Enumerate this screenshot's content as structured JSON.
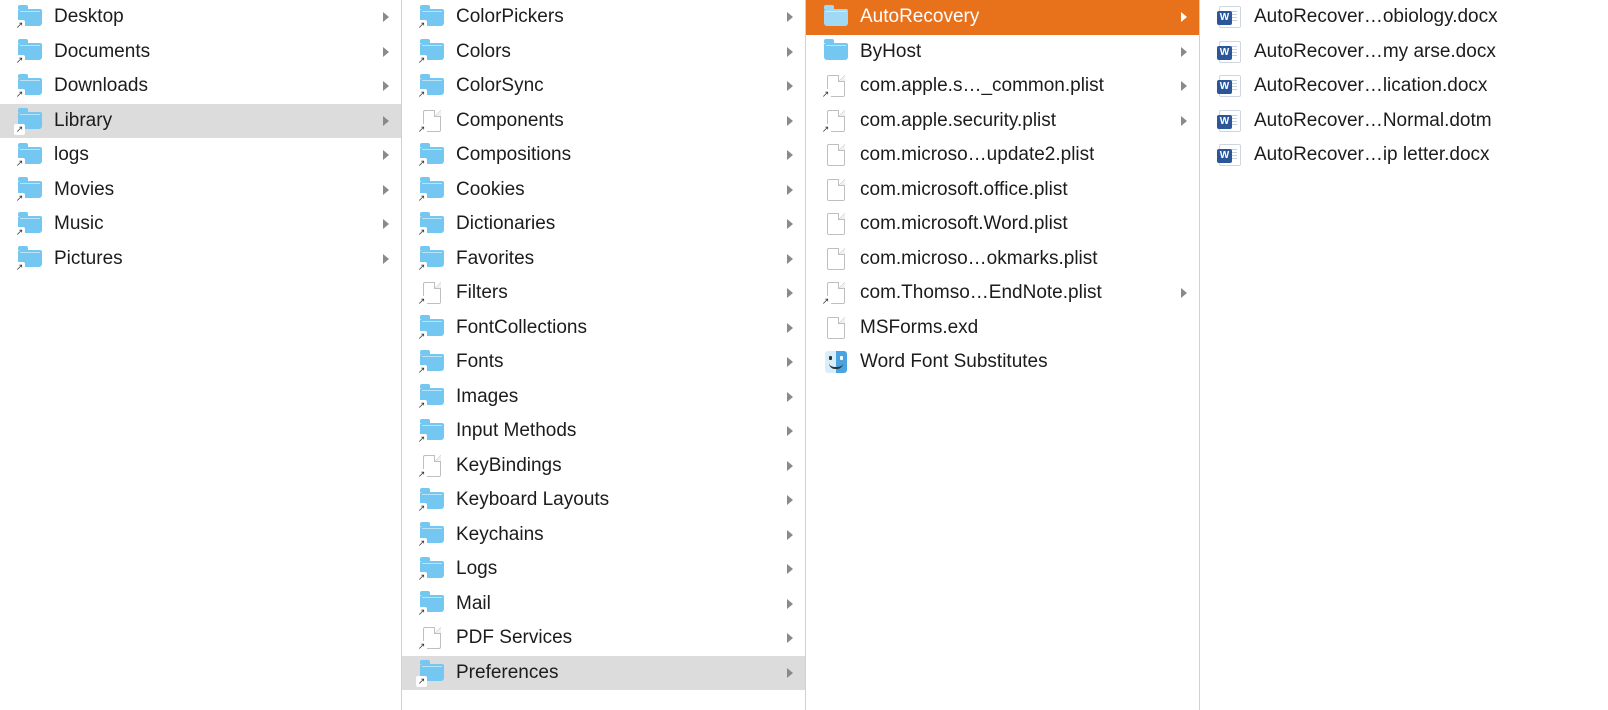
{
  "columns": [
    {
      "id": "home",
      "items": [
        {
          "label": "Desktop",
          "icon": "folder-alias",
          "arrow": true,
          "selected": false
        },
        {
          "label": "Documents",
          "icon": "folder-alias",
          "arrow": true,
          "selected": false
        },
        {
          "label": "Downloads",
          "icon": "folder-alias",
          "arrow": true,
          "selected": false
        },
        {
          "label": "Library",
          "icon": "folder-alias",
          "arrow": true,
          "selected": "gray"
        },
        {
          "label": "logs",
          "icon": "folder-alias",
          "arrow": true,
          "selected": false
        },
        {
          "label": "Movies",
          "icon": "folder-alias",
          "arrow": true,
          "selected": false
        },
        {
          "label": "Music",
          "icon": "folder-alias",
          "arrow": true,
          "selected": false
        },
        {
          "label": "Pictures",
          "icon": "folder-alias",
          "arrow": true,
          "selected": false
        }
      ]
    },
    {
      "id": "library",
      "items": [
        {
          "label": "ColorPickers",
          "icon": "folder-alias",
          "arrow": true
        },
        {
          "label": "Colors",
          "icon": "folder-alias",
          "arrow": true
        },
        {
          "label": "ColorSync",
          "icon": "folder-alias",
          "arrow": true
        },
        {
          "label": "Components",
          "icon": "file-alias",
          "arrow": true
        },
        {
          "label": "Compositions",
          "icon": "folder-alias",
          "arrow": true
        },
        {
          "label": "Cookies",
          "icon": "folder-alias",
          "arrow": true
        },
        {
          "label": "Dictionaries",
          "icon": "folder-alias",
          "arrow": true
        },
        {
          "label": "Favorites",
          "icon": "folder-alias",
          "arrow": true
        },
        {
          "label": "Filters",
          "icon": "file-alias",
          "arrow": true
        },
        {
          "label": "FontCollections",
          "icon": "folder-alias",
          "arrow": true
        },
        {
          "label": "Fonts",
          "icon": "folder-alias",
          "arrow": true
        },
        {
          "label": "Images",
          "icon": "folder-alias",
          "arrow": true
        },
        {
          "label": "Input Methods",
          "icon": "folder-alias",
          "arrow": true
        },
        {
          "label": "KeyBindings",
          "icon": "file-alias",
          "arrow": true
        },
        {
          "label": "Keyboard Layouts",
          "icon": "folder-alias",
          "arrow": true
        },
        {
          "label": "Keychains",
          "icon": "folder-alias",
          "arrow": true
        },
        {
          "label": "Logs",
          "icon": "folder-alias",
          "arrow": true
        },
        {
          "label": "Mail",
          "icon": "folder-alias",
          "arrow": true
        },
        {
          "label": "PDF Services",
          "icon": "file-alias",
          "arrow": true
        },
        {
          "label": "Preferences",
          "icon": "folder-alias",
          "arrow": true,
          "selected": "gray"
        }
      ]
    },
    {
      "id": "preferences",
      "items": [
        {
          "label": "AutoRecovery",
          "icon": "folder",
          "arrow": true,
          "selected": "orange"
        },
        {
          "label": "ByHost",
          "icon": "folder",
          "arrow": true
        },
        {
          "label": "com.apple.s…_common.plist",
          "icon": "file-alias",
          "arrow": true
        },
        {
          "label": "com.apple.security.plist",
          "icon": "file-alias",
          "arrow": true
        },
        {
          "label": "com.microso…update2.plist",
          "icon": "file",
          "arrow": false
        },
        {
          "label": "com.microsoft.office.plist",
          "icon": "file",
          "arrow": false
        },
        {
          "label": "com.microsoft.Word.plist",
          "icon": "file",
          "arrow": false
        },
        {
          "label": "com.microso…okmarks.plist",
          "icon": "file",
          "arrow": false
        },
        {
          "label": "com.Thomso…EndNote.plist",
          "icon": "file-alias",
          "arrow": true
        },
        {
          "label": "MSForms.exd",
          "icon": "file",
          "arrow": false
        },
        {
          "label": "Word Font Substitutes",
          "icon": "finder",
          "arrow": false
        }
      ]
    },
    {
      "id": "autorecovery",
      "items": [
        {
          "label": "AutoRecover…obiology.docx",
          "icon": "word",
          "arrow": false
        },
        {
          "label": "AutoRecover…my arse.docx",
          "icon": "word",
          "arrow": false
        },
        {
          "label": "AutoRecover…lication.docx",
          "icon": "word",
          "arrow": false
        },
        {
          "label": "AutoRecover…Normal.dotm",
          "icon": "word-dotm",
          "arrow": false
        },
        {
          "label": "AutoRecover…ip letter.docx",
          "icon": "word",
          "arrow": false
        }
      ]
    }
  ]
}
